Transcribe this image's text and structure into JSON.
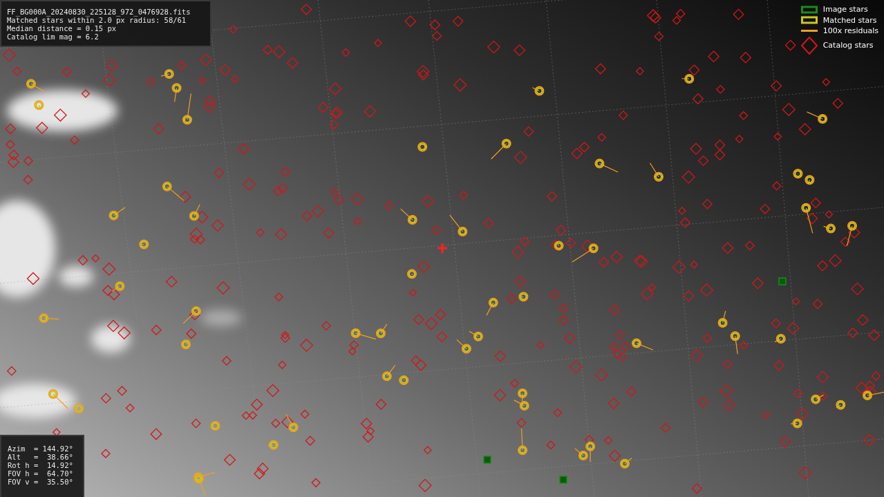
{
  "info_box": {
    "lines": [
      "FF_BG000A_20240830_225128_972_0476928.fits",
      "Matched stars within 2.0 px radius: 58/61",
      "Median distance = 0.15 px",
      "Catalog lim mag = 6.2"
    ]
  },
  "pointing_box": {
    "lines": [
      "Azim  = 144.92°",
      "Alt   =  38.66°",
      "Rot h =  14.92°",
      "FOV h =  64.70°",
      "FOV v =  35.50°"
    ]
  },
  "legend": [
    {
      "kind": "box",
      "label": "Image stars",
      "color": "#1a8a1a"
    },
    {
      "kind": "box",
      "label": "Matched stars",
      "color": "#c8c81e"
    },
    {
      "kind": "line",
      "label": "100x residuals",
      "color": "#f0a020"
    },
    {
      "kind": "diamond",
      "label": "Catalog stars",
      "color": "#d01818"
    }
  ]
}
